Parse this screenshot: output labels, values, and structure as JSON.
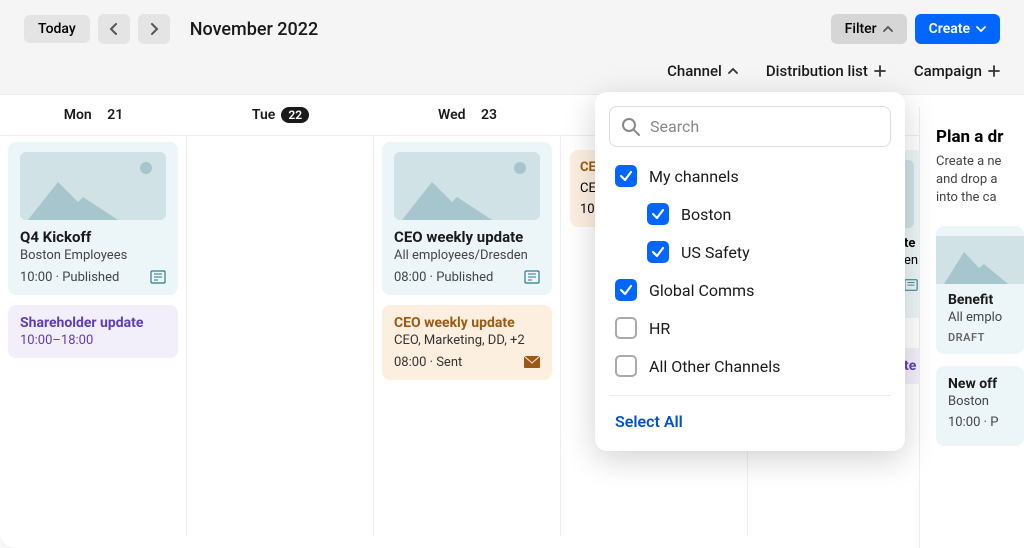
{
  "topbar": {
    "today": "Today",
    "month": "November 2022",
    "filter": "Filter",
    "create": "Create"
  },
  "filters": {
    "channel": "Channel",
    "distribution": "Distribution list",
    "campaign": "Campaign"
  },
  "days": [
    {
      "label": "Mon",
      "num": "21",
      "today": false
    },
    {
      "label": "Tue",
      "num": "22",
      "today": true
    },
    {
      "label": "Wed",
      "num": "23",
      "today": false
    }
  ],
  "mon": {
    "card1": {
      "title": "Q4 Kickoff",
      "sub": "Boston Employees",
      "meta": "10:00 · Published"
    },
    "card2": {
      "title": "Shareholder update",
      "meta": "10:00–18:00"
    }
  },
  "wed": {
    "card1": {
      "title": "CEO weekly update",
      "sub": "All employees/Dresden",
      "meta": "08:00 · Published"
    },
    "card2": {
      "title": "CEO weekly update",
      "sub": "CEO, Marketing, DD, +2",
      "meta": "08:00 · Sent"
    }
  },
  "thu_partial": {
    "title": "CE",
    "sub": "CE",
    "meta": "10"
  },
  "thu_partial_right": {
    "title": "te",
    "sub": "en",
    "purple": "te"
  },
  "dropdown": {
    "placeholder": "Search",
    "items": [
      {
        "label": "My channels",
        "checked": true,
        "indent": false
      },
      {
        "label": "Boston",
        "checked": true,
        "indent": true
      },
      {
        "label": "US Safety",
        "checked": true,
        "indent": true
      },
      {
        "label": "Global Comms",
        "checked": true,
        "indent": false
      },
      {
        "label": "HR",
        "checked": false,
        "indent": false
      },
      {
        "label": "All Other Channels",
        "checked": false,
        "indent": false
      }
    ],
    "selectAll": "Select All"
  },
  "side": {
    "title": "Plan a dr",
    "text1": "Create a ne",
    "text2": "and drop a",
    "text3": "into the ca",
    "card1": {
      "title": "Benefit",
      "sub": "All emplo",
      "badge": "DRAFT"
    },
    "card2": {
      "title": "New off",
      "sub": "Boston",
      "meta": "10:00 · P"
    }
  }
}
